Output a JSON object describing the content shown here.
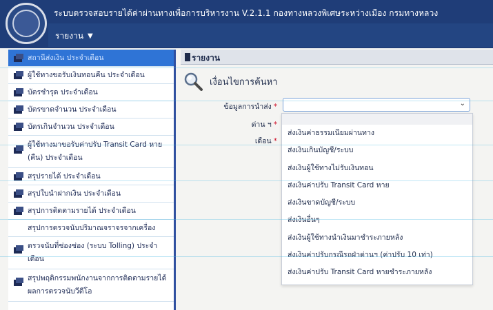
{
  "header": {
    "app_title": "ระบบตรวจสอบรายได้ค่าผ่านทางเพื่อการบริหารงาน V.2.1.1 กองทางหลวงพิเศษระหว่างเมือง กรมทางหลวง",
    "menu_label": "รายงาน"
  },
  "sidebar": {
    "items": [
      {
        "label": "สถานีส่งเงิน ประจำเดือน"
      },
      {
        "label": "ผู้ใช้ทางขอรับเงินทอนคืน ประจำเดือน"
      },
      {
        "label": "บัตรชำรุด ประจำเดือน"
      },
      {
        "label": "บัตรขาดจำนวน ประจำเดือน"
      },
      {
        "label": "บัตรเกินจำนวน ประจำเดือน"
      },
      {
        "label": "ผู้ใช้ทางมาขอรับค่าปรับ Transit Card หาย (คืน) ประจำเดือน"
      },
      {
        "label": "สรุปรายได้ ประจำเดือน"
      },
      {
        "label": "สรุปใบนำฝากเงิน ประจำเดือน"
      },
      {
        "label": "สรุปการติดตามรายได้ ประจำเดือน"
      },
      {
        "label": "สรุปการตรวจนับปริมาณจราจรจากเครื่อง"
      },
      {
        "label": "ตรวจนับที่ช่องช่อง (ระบบ Tolling) ประจำเดือน"
      },
      {
        "label": "สรุปพฤติกรรมพนักงานจากการติดตามรายได้ผลการตรวจนับวีดีโอ"
      }
    ]
  },
  "main": {
    "section_title": "รายงาน",
    "search_title": "เงื่อนไขการค้นหา",
    "fields": {
      "data_label": "ข้อมูลการนำส่ง",
      "branch_label": "ด่าน ฯ",
      "month_label": "เดือน"
    },
    "dropdown_options": [
      "ส่งเงินค่าธรรมเนียมผ่านทาง",
      "ส่งเงินเกินบัญชี/ระบบ",
      "ส่งเงินผู้ใช้ทางไม่รับเงินทอน",
      "ส่งเงินค่าปรับ Transit Card หาย",
      "ส่งเงินขาดบัญชี/ระบบ",
      "ส่งเงินอื่นๆ",
      "ส่งเงินผู้ใช้ทางนำเงินมาชำระภายหลัง",
      "ส่งเงินค่าปรับกรณีรถฝ่าด่านฯ (ค่าปรับ 10 เท่า)",
      "ส่งเงินค่าปรับ Transit Card หายชำระภายหลัง"
    ]
  },
  "colors": {
    "header_bg": "#1f3d78",
    "active_item": "#2f74d6",
    "required": "#d0102a"
  }
}
